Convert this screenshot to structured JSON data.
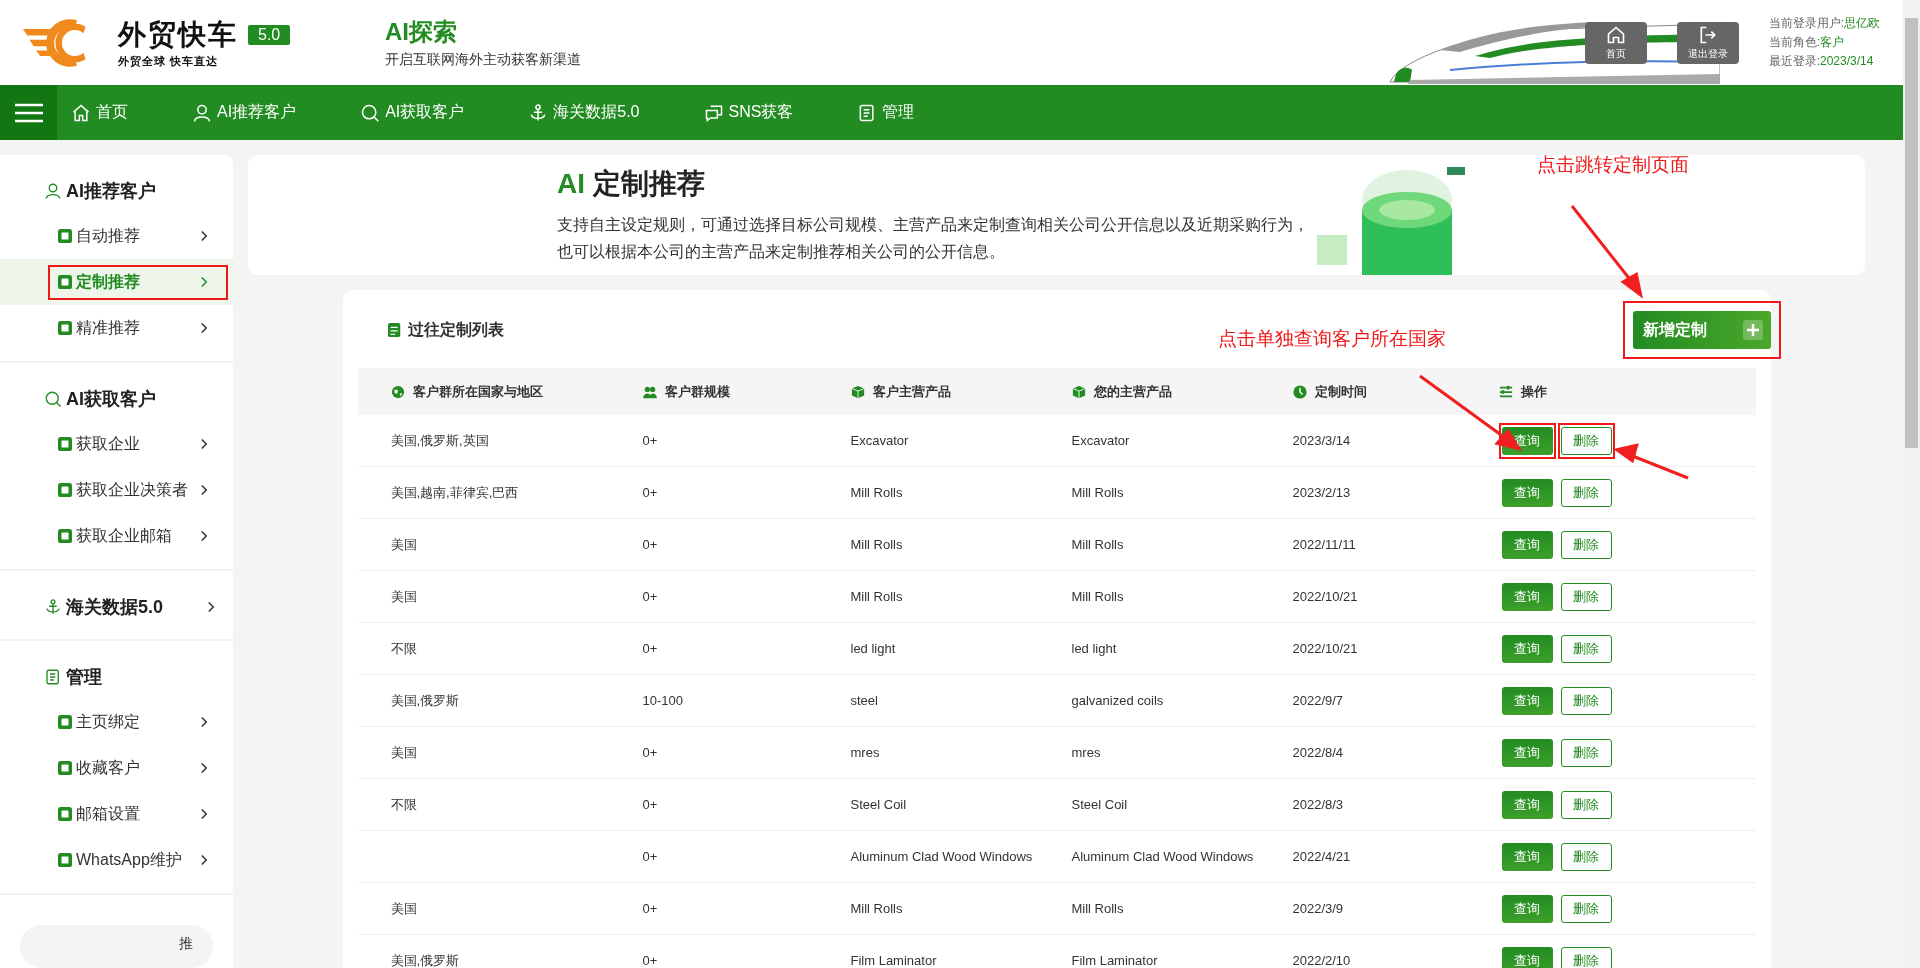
{
  "header": {
    "logo": {
      "name": "外贸快车",
      "version": "5.0",
      "slogan": "外贸全球 快车直达"
    },
    "title": "AI探索",
    "subtitle": "开启互联网海外主动获客新渠道",
    "quick_buttons": [
      {
        "label": "首页"
      },
      {
        "label": "退出登录"
      }
    ],
    "user_info": [
      {
        "label": "当前登录用户:",
        "value": "思亿欧"
      },
      {
        "label": "当前角色:",
        "value": "客户"
      },
      {
        "label": "最近登录:",
        "value": "2023/3/14"
      }
    ]
  },
  "nav": [
    {
      "label": "首页"
    },
    {
      "label": "AI推荐客户"
    },
    {
      "label": "AI获取客户"
    },
    {
      "label": "海关数据5.0"
    },
    {
      "label": "SNS获客"
    },
    {
      "label": "管理"
    }
  ],
  "sidebar": {
    "sections": [
      {
        "title": "AI推荐客户",
        "items": [
          {
            "label": "自动推荐",
            "selected": false,
            "highlighted": false
          },
          {
            "label": "定制推荐",
            "selected": true,
            "highlighted": true
          },
          {
            "label": "精准推荐",
            "selected": false,
            "highlighted": false
          }
        ]
      },
      {
        "title": "AI获取客户",
        "items": [
          {
            "label": "获取企业",
            "selected": false,
            "highlighted": false
          },
          {
            "label": "获取企业决策者",
            "selected": false,
            "highlighted": false
          },
          {
            "label": "获取企业邮箱",
            "selected": false,
            "highlighted": false
          }
        ]
      },
      {
        "title": "海关数据5.0"
      },
      {
        "title": "管理",
        "items": [
          {
            "label": "主页绑定",
            "selected": false,
            "highlighted": false
          },
          {
            "label": "收藏客户",
            "selected": false,
            "highlighted": false
          },
          {
            "label": "邮箱设置",
            "selected": false,
            "highlighted": false
          },
          {
            "label": "WhatsApp维护",
            "selected": false,
            "highlighted": false
          }
        ]
      }
    ],
    "footer_text": "推"
  },
  "banner": {
    "title_accent": "AI",
    "title": "定制推荐",
    "description": "支持自主设定规则，可通过选择目标公司规模、主营产品来定制查询相关公司公开信息以及近期采购行为，也可以根据本公司的主营产品来定制推荐相关公司的公开信息。"
  },
  "table": {
    "title": "过往定制列表",
    "new_button": {
      "label": "新增定制",
      "highlighted": true
    },
    "columns": [
      "客户群所在国家与地区",
      "客户群规模",
      "客户主营产品",
      "您的主营产品",
      "定制时间",
      "操作"
    ],
    "rows": [
      {
        "country": "美国,俄罗斯,英国",
        "scale": "0+",
        "customer_product": "Excavator",
        "your_product": "Excavator",
        "time": "2023/3/14",
        "actions": [
          {
            "kind": "query",
            "label": "查询",
            "highlighted": true
          },
          {
            "kind": "delete",
            "label": "删除",
            "highlighted": true
          }
        ]
      },
      {
        "country": "美国,越南,菲律宾,巴西",
        "scale": "0+",
        "customer_product": "Mill Rolls",
        "your_product": "Mill Rolls",
        "time": "2023/2/13",
        "actions": [
          {
            "kind": "query",
            "label": "查询",
            "highlighted": false
          },
          {
            "kind": "delete",
            "label": "删除",
            "highlighted": false
          }
        ]
      },
      {
        "country": "美国",
        "scale": "0+",
        "customer_product": "Mill Rolls",
        "your_product": "Mill Rolls",
        "time": "2022/11/11",
        "actions": [
          {
            "kind": "query",
            "label": "查询",
            "highlighted": false
          },
          {
            "kind": "delete",
            "label": "删除",
            "highlighted": false
          }
        ]
      },
      {
        "country": "美国",
        "scale": "0+",
        "customer_product": "Mill Rolls",
        "your_product": "Mill Rolls",
        "time": "2022/10/21",
        "actions": [
          {
            "kind": "query",
            "label": "查询",
            "highlighted": false
          },
          {
            "kind": "delete",
            "label": "删除",
            "highlighted": false
          }
        ]
      },
      {
        "country": "不限",
        "scale": "0+",
        "customer_product": "led light",
        "your_product": "led light",
        "time": "2022/10/21",
        "actions": [
          {
            "kind": "query",
            "label": "查询",
            "highlighted": false
          },
          {
            "kind": "delete",
            "label": "删除",
            "highlighted": false
          }
        ]
      },
      {
        "country": "美国,俄罗斯",
        "scale": "10-100",
        "customer_product": "steel",
        "your_product": "galvanized coils",
        "time": "2022/9/7",
        "actions": [
          {
            "kind": "query",
            "label": "查询",
            "highlighted": false
          },
          {
            "kind": "delete",
            "label": "删除",
            "highlighted": false
          }
        ]
      },
      {
        "country": "美国",
        "scale": "0+",
        "customer_product": "mres",
        "your_product": "mres",
        "time": "2022/8/4",
        "actions": [
          {
            "kind": "query",
            "label": "查询",
            "highlighted": false
          },
          {
            "kind": "delete",
            "label": "删除",
            "highlighted": false
          }
        ]
      },
      {
        "country": "不限",
        "scale": "0+",
        "customer_product": "Steel Coil",
        "your_product": "Steel Coil",
        "time": "2022/8/3",
        "actions": [
          {
            "kind": "query",
            "label": "查询",
            "highlighted": false
          },
          {
            "kind": "delete",
            "label": "删除",
            "highlighted": false
          }
        ]
      },
      {
        "scale": "0+",
        "customer_product": "Aluminum Clad Wood Windows",
        "your_product": "Aluminum Clad Wood Windows",
        "time": "2022/4/21",
        "actions": [
          {
            "kind": "query",
            "label": "查询",
            "highlighted": false
          },
          {
            "kind": "delete",
            "label": "删除",
            "highlighted": false
          }
        ]
      },
      {
        "country": "美国",
        "scale": "0+",
        "customer_product": "Mill Rolls",
        "your_product": "Mill Rolls",
        "time": "2022/3/9",
        "actions": [
          {
            "kind": "query",
            "label": "查询",
            "highlighted": false
          },
          {
            "kind": "delete",
            "label": "删除",
            "highlighted": false
          }
        ]
      },
      {
        "country": "美国,俄罗斯",
        "scale": "0+",
        "customer_product": "Film Laminator",
        "your_product": "Film Laminator",
        "time": "2022/2/10",
        "actions": [
          {
            "kind": "query",
            "label": "查询",
            "highlighted": false
          },
          {
            "kind": "delete",
            "label": "删除",
            "highlighted": false
          }
        ]
      }
    ]
  },
  "annotations": [
    {
      "text": "点击跳转定制页面"
    },
    {
      "text": "点击单独查询客户所在国家"
    }
  ]
}
